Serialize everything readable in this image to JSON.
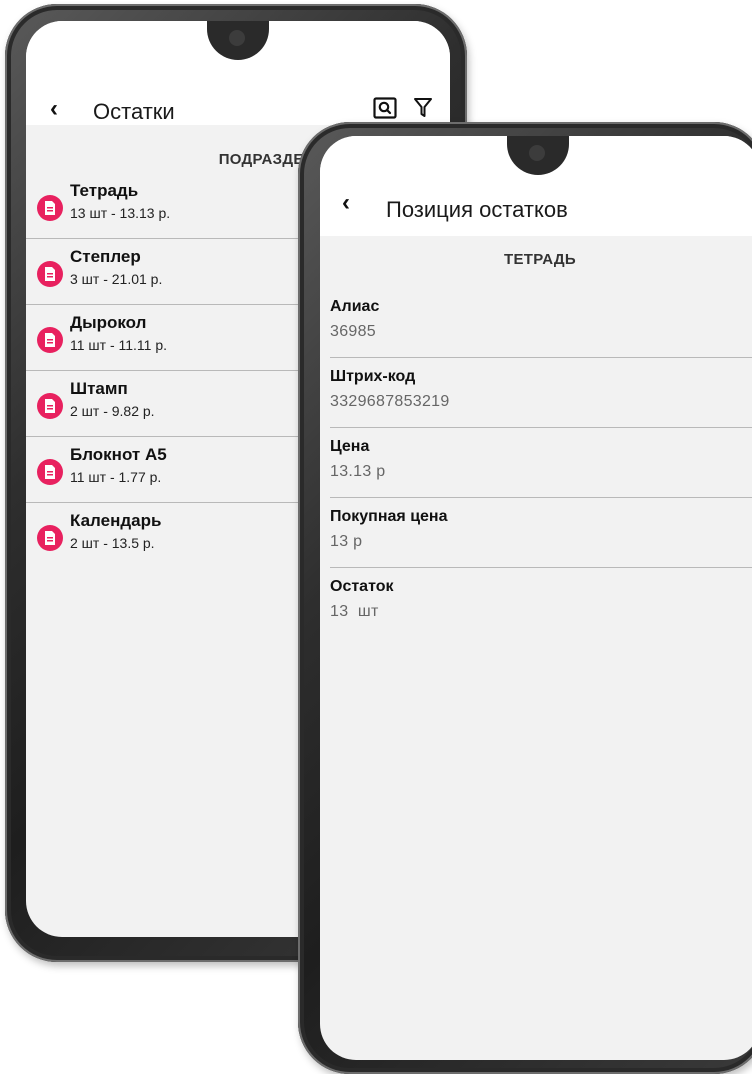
{
  "list_screen": {
    "title": "Остатки",
    "section_header": "ПОДРАЗДЕЛЕНИЕ",
    "items": [
      {
        "name": "Тетрадь",
        "details": "13 шт - 13.13 р."
      },
      {
        "name": "Степлер",
        "details": "3 шт - 21.01 р."
      },
      {
        "name": "Дырокол",
        "details": "11 шт - 11.11 р."
      },
      {
        "name": "Штамп",
        "details": "2 шт - 9.82 р."
      },
      {
        "name": "Блокнот А5",
        "details": "11 шт - 1.77 р."
      },
      {
        "name": "Календарь",
        "details": "2 шт - 13.5 р."
      }
    ],
    "icons": {
      "back": "chevron-left-icon",
      "search": "search-icon",
      "filter": "filter-icon",
      "item": "document-icon"
    },
    "colors": {
      "item_icon": "#e8215f"
    }
  },
  "detail_screen": {
    "title": "Позиция остатков",
    "section_header": "ТЕТРАДЬ",
    "fields": [
      {
        "label": "Алиас",
        "value": "36985"
      },
      {
        "label": "Штрих-код",
        "value": "3329687853219"
      },
      {
        "label": "Цена",
        "value": "13.13 р"
      },
      {
        "label": "Покупная цена",
        "value": "13 р"
      },
      {
        "label": "Остаток",
        "value": "13  шт"
      }
    ],
    "icons": {
      "back": "chevron-left-icon"
    }
  }
}
